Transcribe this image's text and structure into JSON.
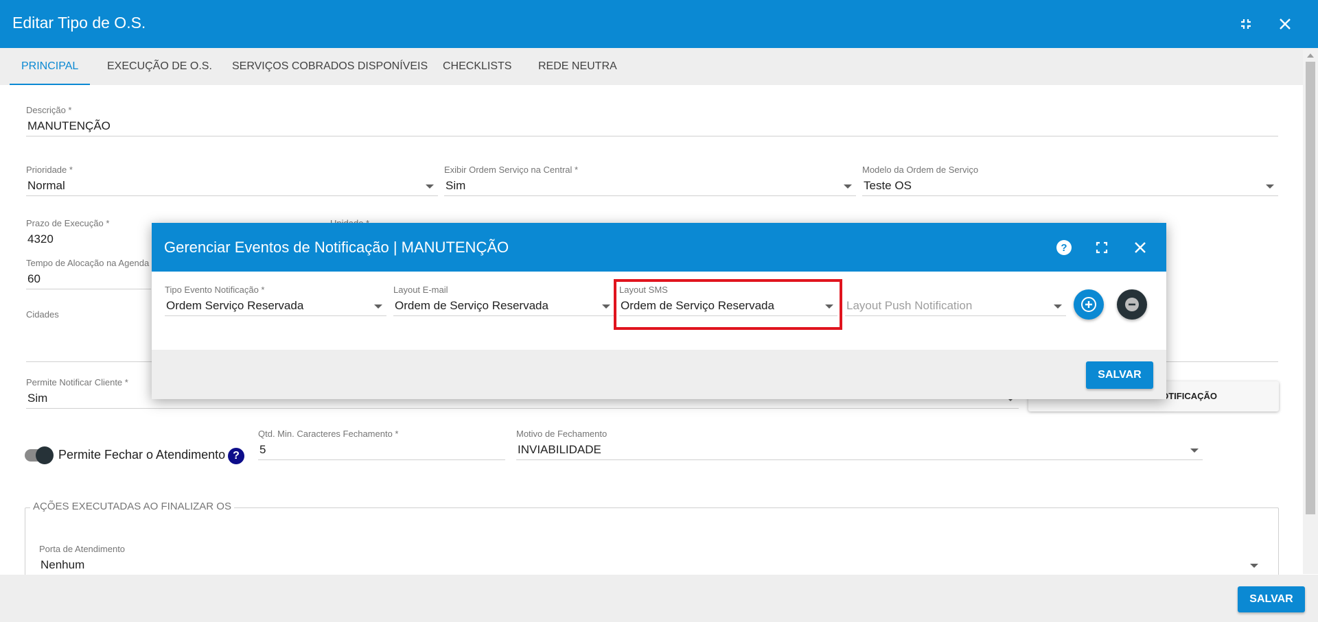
{
  "header": {
    "title": "Editar Tipo de O.S."
  },
  "tabs": [
    {
      "label": "PRINCIPAL"
    },
    {
      "label": "EXECUÇÃO DE O.S."
    },
    {
      "label": "SERVIÇOS COBRADOS DISPONÍVEIS"
    },
    {
      "label": "CHECKLISTS"
    },
    {
      "label": "REDE NEUTRA"
    }
  ],
  "form": {
    "descricao": {
      "label": "Descrição *",
      "value": "MANUTENÇÃO"
    },
    "prioridade": {
      "label": "Prioridade *",
      "value": "Normal"
    },
    "exibir_central": {
      "label": "Exibir Ordem Serviço na Central *",
      "value": "Sim"
    },
    "modelo_os": {
      "label": "Modelo da Ordem de Serviço",
      "value": "Teste OS"
    },
    "prazo_execucao": {
      "label": "Prazo de Execução *",
      "value": "4320"
    },
    "unidade": {
      "label": "Unidade *"
    },
    "tempo_alocacao": {
      "label": "Tempo de Alocação na Agenda",
      "value": "60"
    },
    "cidades": {
      "label": "Cidades"
    },
    "permite_notificar": {
      "label": "Permite Notificar Cliente *",
      "value": "Sim"
    },
    "notif_button_label": "S NOTIFICAÇÃO",
    "permite_fechar_label": "Permite Fechar o Atendimento",
    "help_symbol": "?",
    "qtd_min": {
      "label": "Qtd. Min. Caracteres Fechamento *",
      "value": "5"
    },
    "motivo_fechamento": {
      "label": "Motivo de Fechamento",
      "value": "INVIABILIDADE"
    },
    "acoes_legend": "AÇÕES EXECUTADAS AO FINALIZAR OS",
    "porta_atendimento": {
      "label": "Porta de Atendimento",
      "value": "Nenhum"
    }
  },
  "footer": {
    "save_label": "SALVAR"
  },
  "dialog": {
    "title": "Gerenciar Eventos de Notificação | MANUTENÇÃO",
    "tipo_evento": {
      "label": "Tipo Evento Notificação *",
      "value": "Ordem Serviço Reservada"
    },
    "layout_email": {
      "label": "Layout E-mail",
      "value": "Ordem de Serviço Reservada"
    },
    "layout_sms": {
      "label": "Layout SMS",
      "value": "Ordem de Serviço Reservada"
    },
    "layout_push": {
      "placeholder": "Layout Push Notification"
    },
    "save_label": "SALVAR"
  },
  "icons": {
    "minimize": "minimize-icon",
    "close": "close-icon",
    "help": "help-icon",
    "fullscreen": "fullscreen-icon",
    "add": "add-circle-icon",
    "remove": "remove-circle-icon"
  },
  "colors": {
    "primary": "#0b89d3",
    "highlight": "#e0141e",
    "remove_button": "#263238"
  }
}
